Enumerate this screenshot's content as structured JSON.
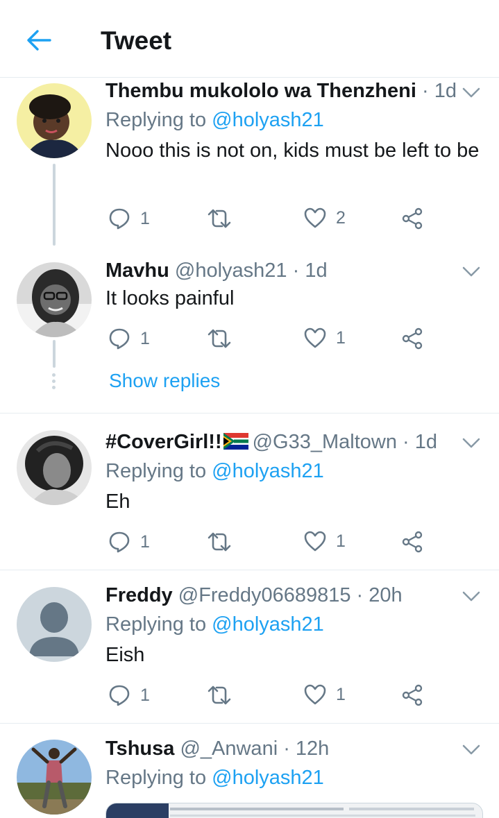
{
  "header": {
    "title": "Tweet",
    "back_icon": "arrow-left-icon",
    "accent": "#1da1f2"
  },
  "replies": [
    {
      "name": "Thembu mukololo wa Thenzheni",
      "handle": "",
      "time": "1d",
      "replying_prefix": "Replying to",
      "replying_to": "@holyash21",
      "text": "Nooo this is not on, kids must be left to be",
      "reply_count": "1",
      "retweet_count": "",
      "like_count": "2"
    },
    {
      "name": "Mavhu",
      "handle": "@holyash21",
      "time": "1d",
      "text": "It looks painful",
      "reply_count": "1",
      "retweet_count": "",
      "like_count": "1",
      "show_replies": "Show replies"
    },
    {
      "name": "#CoverGirl!!",
      "handle": "@G33_Maltown",
      "time": "1d",
      "replying_prefix": "Replying to",
      "replying_to": "@holyash21",
      "text": "Eh",
      "reply_count": "1",
      "retweet_count": "",
      "like_count": "1"
    },
    {
      "name": "Freddy",
      "handle": "@Freddy06689815",
      "time": "20h",
      "replying_prefix": "Replying to",
      "replying_to": "@holyash21",
      "text": "Eish",
      "reply_count": "1",
      "retweet_count": "",
      "like_count": "1"
    },
    {
      "name": "Tshusa",
      "handle": "@_Anwani",
      "time": "12h",
      "replying_prefix": "Replying to",
      "replying_to": "@holyash21"
    }
  ],
  "icons": {
    "reply": "reply-icon",
    "retweet": "retweet-icon",
    "like": "heart-icon",
    "share": "share-icon",
    "menu": "chevron-down-icon"
  },
  "colors": {
    "text": "#14171a",
    "muted": "#657786",
    "link": "#1da1f2",
    "divider": "#e6ecf0"
  }
}
